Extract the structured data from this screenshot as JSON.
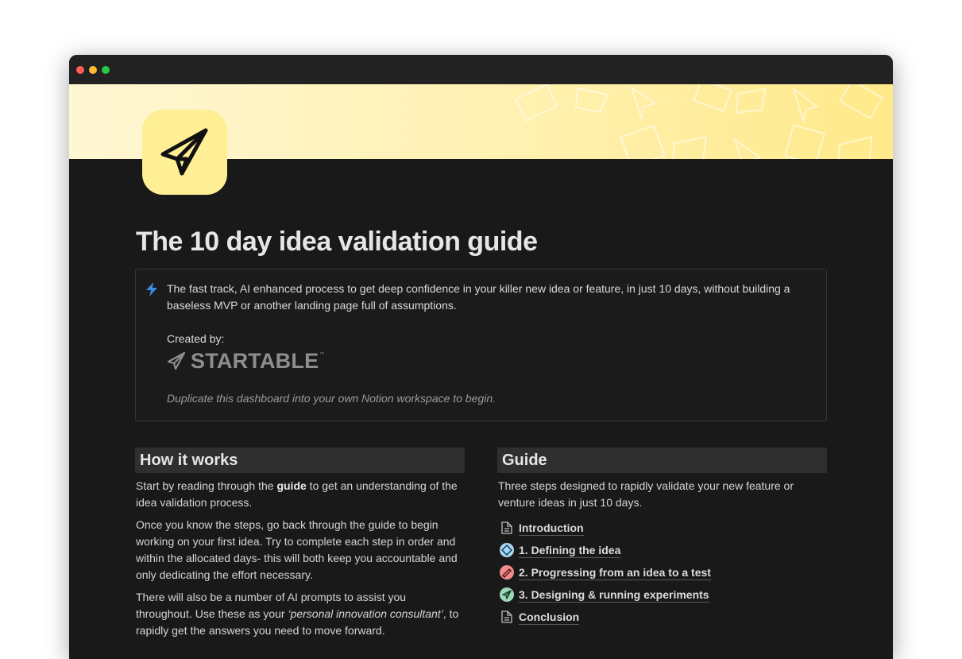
{
  "page": {
    "title": "The 10 day idea validation guide",
    "callout": {
      "text": "The fast track, AI enhanced process to get deep confidence in your killer new idea or feature, in just 10 days, without building a baseless MVP or another landing page full of assumptions.",
      "created_by_label": "Created by:",
      "brand_name": "STARTABLE",
      "brand_tm": "™",
      "note": "Duplicate this dashboard into your own Notion workspace to begin."
    }
  },
  "how_it_works": {
    "heading": "How it works",
    "p1_before": "Start by reading through the ",
    "p1_bold": "guide",
    "p1_after": " to get an understanding of the idea validation process.",
    "p2": "Once you know the steps, go back through the guide to begin working on your first idea. Try to complete each step in order and within the allocated days- this will both keep you accountable and only dedicating the effort necessary.",
    "p3_before": "There will also be a number of AI prompts to assist you throughout. Use these as your ",
    "p3_italic": "‘personal innovation consultant’",
    "p3_after": ", to rapidly get the answers you need to move forward."
  },
  "guide": {
    "heading": "Guide",
    "description": "Three steps designed to rapidly validate your new feature or venture ideas in just 10 days.",
    "links": [
      {
        "label": "Introduction",
        "icon": "document-icon"
      },
      {
        "label": "1. Defining the idea",
        "icon": "diamond-icon"
      },
      {
        "label": "2. Progressing from an idea to a test",
        "icon": "pencil-icon"
      },
      {
        "label": "3. Designing & running experiments",
        "icon": "paper-plane-icon"
      },
      {
        "label": "Conclusion",
        "icon": "document-icon"
      }
    ]
  },
  "colors": {
    "background": "#191919",
    "cover_yellow": "#fff1b0",
    "icon_yellow": "#ffef94",
    "callout_icon": "#3b8ae0"
  }
}
